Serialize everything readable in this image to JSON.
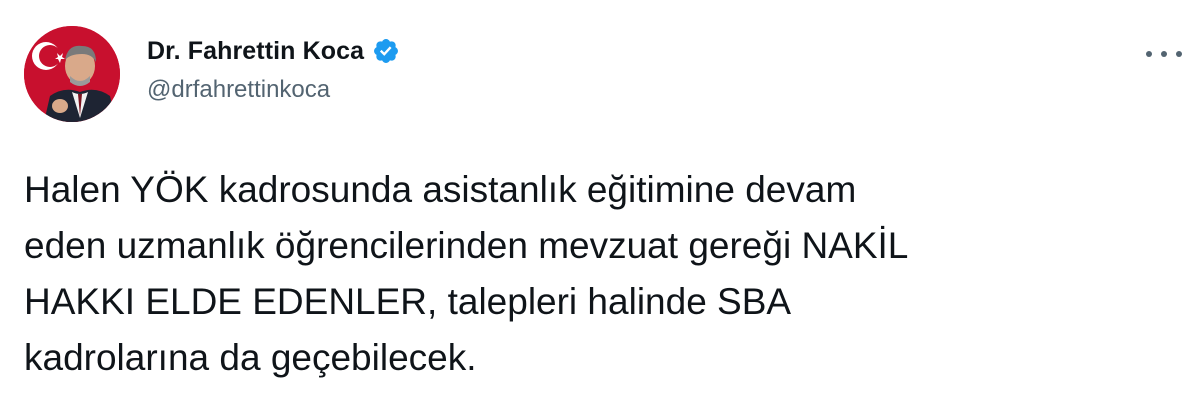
{
  "author": {
    "display_name": "Dr. Fahrettin Koca",
    "handle": "@drfahrettinkoca",
    "verified": true
  },
  "tweet": {
    "text": "Halen YÖK kadrosunda asistanlık eğitimine devam\neden uzmanlık öğrencilerinden mevzuat gereği NAKİL\nHAKKI ELDE EDENLER, talepleri halinde SBA\nkadrolarına da geçebilecek."
  },
  "icons": {
    "verified": "verified-badge-icon",
    "more": "more-options-icon"
  },
  "colors": {
    "verified_blue": "#1d9bf0",
    "text_primary": "#0f1419",
    "text_secondary": "#536471"
  }
}
